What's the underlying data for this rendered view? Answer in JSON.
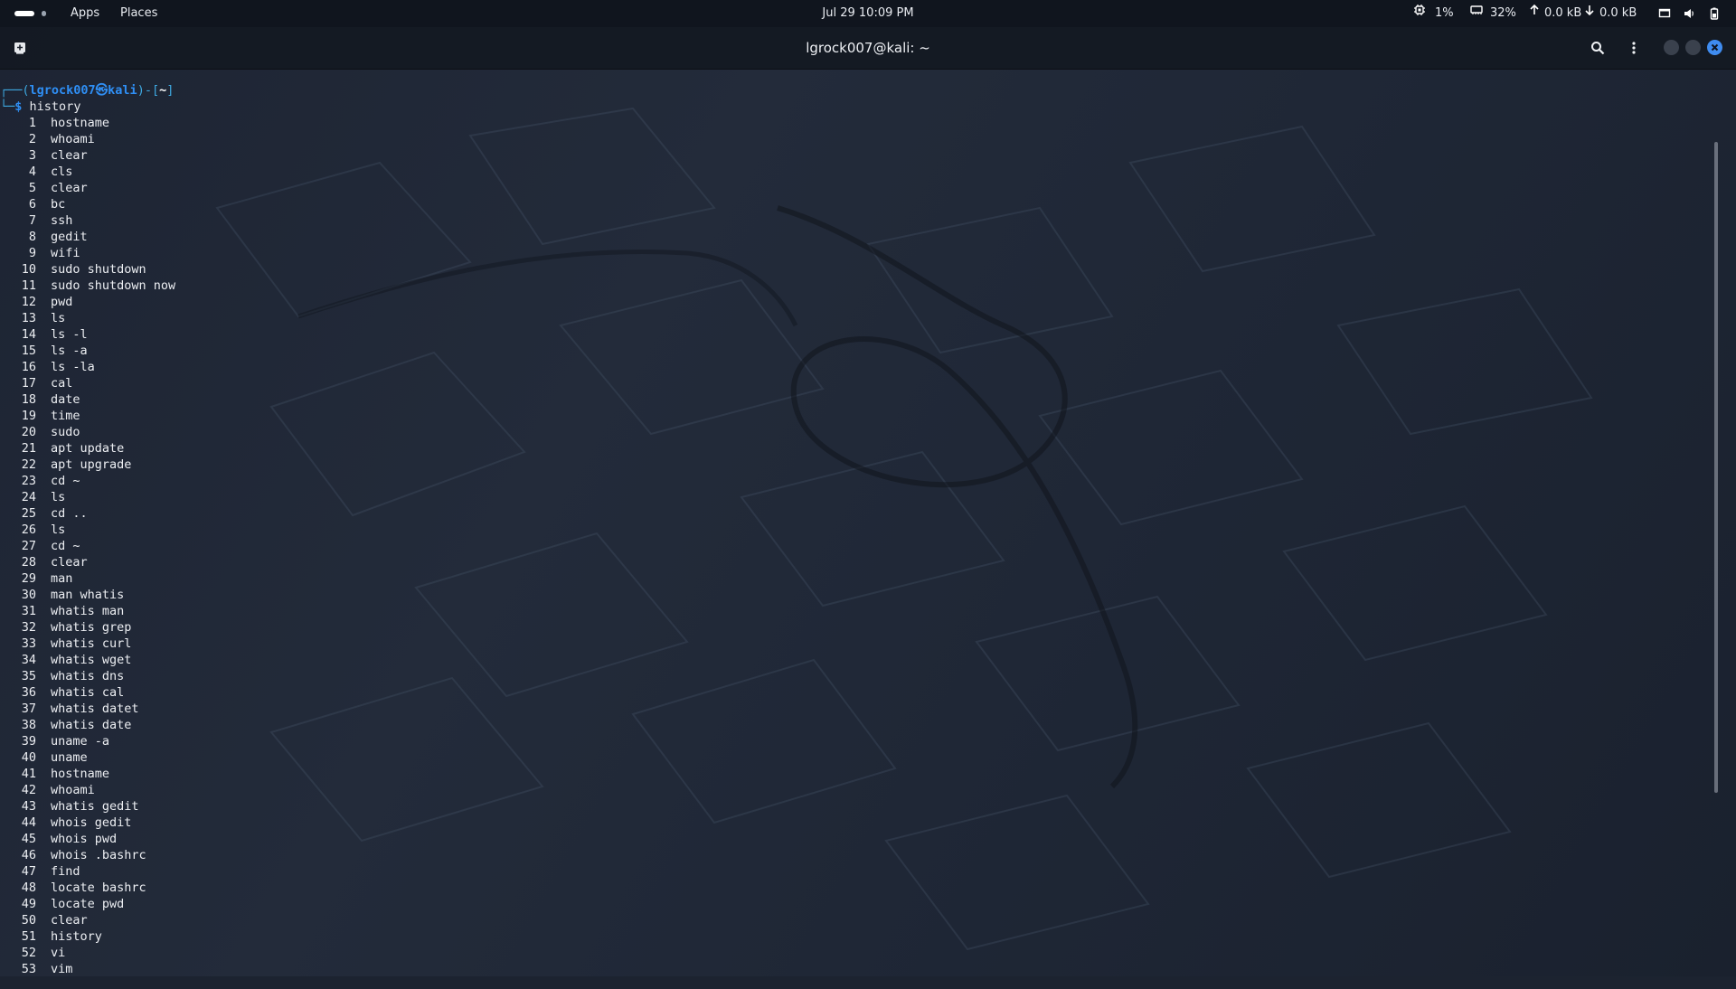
{
  "top_panel": {
    "apps_label": "Apps",
    "places_label": "Places",
    "clock": "Jul 29  10:09 PM",
    "cpu": "1%",
    "memory": "32%",
    "net_up": "0.0 kB",
    "net_down": "0.0 kB",
    "icons": [
      "cpu-icon",
      "memory-icon",
      "arrow-up-icon",
      "arrow-down-icon",
      "display-icon",
      "volume-icon",
      "battery-icon"
    ]
  },
  "titlebar": {
    "title": "lgrock007@kali: ~",
    "icons": [
      "new-tab-icon",
      "search-icon",
      "kebab-menu-icon",
      "minimize-icon",
      "maximize-icon",
      "close-icon"
    ]
  },
  "colors": {
    "prompt_blue": "#2f8ff5",
    "prompt_frame": "#3ea8e0",
    "close_blue": "#3f8cf0"
  },
  "terminal": {
    "prompt": {
      "frame_open": "┌──(",
      "user": "lgrock007",
      "at_symbol": "㉿",
      "host": "kali",
      "frame_mid": ")-[",
      "dir": "~",
      "frame_close": "]",
      "second_line_prefix": "└─",
      "dollar": "$",
      "command": "history"
    },
    "history": [
      {
        "n": "1",
        "cmd": "hostname"
      },
      {
        "n": "2",
        "cmd": "whoami"
      },
      {
        "n": "3",
        "cmd": "clear"
      },
      {
        "n": "4",
        "cmd": "cls"
      },
      {
        "n": "5",
        "cmd": "clear"
      },
      {
        "n": "6",
        "cmd": "bc"
      },
      {
        "n": "7",
        "cmd": "ssh"
      },
      {
        "n": "8",
        "cmd": "gedit"
      },
      {
        "n": "9",
        "cmd": "wifi"
      },
      {
        "n": "10",
        "cmd": "sudo shutdown"
      },
      {
        "n": "11",
        "cmd": "sudo shutdown now"
      },
      {
        "n": "12",
        "cmd": "pwd"
      },
      {
        "n": "13",
        "cmd": "ls"
      },
      {
        "n": "14",
        "cmd": "ls -l"
      },
      {
        "n": "15",
        "cmd": "ls -a"
      },
      {
        "n": "16",
        "cmd": "ls -la"
      },
      {
        "n": "17",
        "cmd": "cal"
      },
      {
        "n": "18",
        "cmd": "date"
      },
      {
        "n": "19",
        "cmd": "time"
      },
      {
        "n": "20",
        "cmd": "sudo"
      },
      {
        "n": "21",
        "cmd": "apt update"
      },
      {
        "n": "22",
        "cmd": "apt upgrade"
      },
      {
        "n": "23",
        "cmd": "cd ~"
      },
      {
        "n": "24",
        "cmd": "ls"
      },
      {
        "n": "25",
        "cmd": "cd .."
      },
      {
        "n": "26",
        "cmd": "ls"
      },
      {
        "n": "27",
        "cmd": "cd ~"
      },
      {
        "n": "28",
        "cmd": "clear"
      },
      {
        "n": "29",
        "cmd": "man"
      },
      {
        "n": "30",
        "cmd": "man whatis"
      },
      {
        "n": "31",
        "cmd": "whatis man"
      },
      {
        "n": "32",
        "cmd": "whatis grep"
      },
      {
        "n": "33",
        "cmd": "whatis curl"
      },
      {
        "n": "34",
        "cmd": "whatis wget"
      },
      {
        "n": "35",
        "cmd": "whatis dns"
      },
      {
        "n": "36",
        "cmd": "whatis cal"
      },
      {
        "n": "37",
        "cmd": "whatis datet"
      },
      {
        "n": "38",
        "cmd": "whatis date"
      },
      {
        "n": "39",
        "cmd": "uname -a"
      },
      {
        "n": "40",
        "cmd": "uname"
      },
      {
        "n": "41",
        "cmd": "hostname"
      },
      {
        "n": "42",
        "cmd": "whoami"
      },
      {
        "n": "43",
        "cmd": "whatis gedit"
      },
      {
        "n": "44",
        "cmd": "whois gedit"
      },
      {
        "n": "45",
        "cmd": "whois pwd"
      },
      {
        "n": "46",
        "cmd": "whois .bashrc"
      },
      {
        "n": "47",
        "cmd": "find"
      },
      {
        "n": "48",
        "cmd": "locate bashrc"
      },
      {
        "n": "49",
        "cmd": "locate pwd"
      },
      {
        "n": "50",
        "cmd": "clear"
      },
      {
        "n": "51",
        "cmd": "history"
      },
      {
        "n": "52",
        "cmd": "vi"
      },
      {
        "n": "53",
        "cmd": "vim"
      }
    ]
  }
}
